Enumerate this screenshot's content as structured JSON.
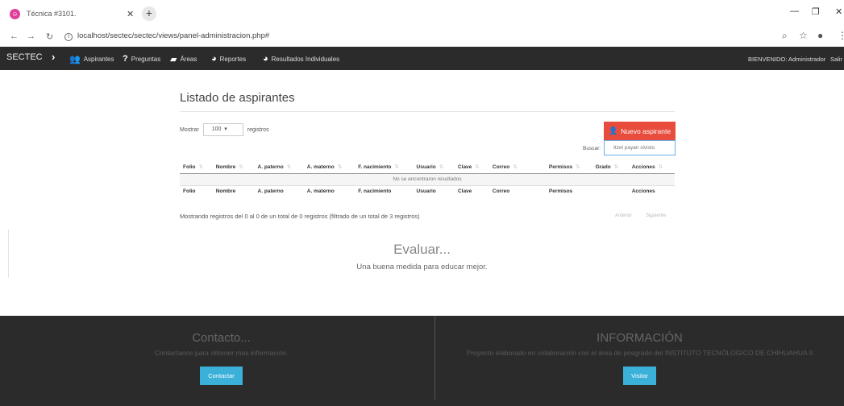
{
  "browser": {
    "tab_title": "Técnica #3101.",
    "url": "localhost/sectec/sectec/views/panel-administracion.php#"
  },
  "navbar": {
    "brand": "SECTEC",
    "items": [
      {
        "label": "Aspirantes",
        "icon": "users-icon"
      },
      {
        "label": "Preguntas",
        "icon": "question-icon"
      },
      {
        "label": "Áreas",
        "icon": "book-icon"
      },
      {
        "label": "Reportes",
        "icon": "pie-chart-icon"
      },
      {
        "label": "Resultados Individuales",
        "icon": "pie-chart-icon"
      }
    ],
    "welcome": "BIENVENIDO: Administrador",
    "logout": "Salir"
  },
  "main": {
    "title": "Listado de aspirantes",
    "show_label": "Mostrar",
    "show_value": "100",
    "records_label": "registros",
    "new_button": "Nuevo aspirante",
    "search_label": "Buscar:",
    "search_value": "Itzel payan sivisto",
    "columns": [
      "Folio",
      "Nombre",
      "A. paterno",
      "A. materno",
      "F. nacimiento",
      "Usuario",
      "Clave",
      "Correo",
      "Permisos",
      "Grado",
      "Acciones"
    ],
    "footer_columns": [
      "Folio",
      "Nombre",
      "A. paterno",
      "A. materno",
      "F. nacimiento",
      "Usuario",
      "Clave",
      "Correo",
      "Permisos",
      "Acciones"
    ],
    "empty_message": "No se encontraron resultados",
    "info": "Mostrando registros del 0 al 0 de un total de 0 registros (filtrado de un total de 3 registros)",
    "prev": "Anterior",
    "next": "Siguiente"
  },
  "hero": {
    "title": "Evaluar...",
    "subtitle": "Una buena medida para educar mejor."
  },
  "footer": {
    "contact_title": "Contacto...",
    "contact_text": "Contactanos para obtener mas información.",
    "contact_button": "Contactar",
    "info_title": "INFORMACIÓN",
    "info_text": "Proyecto elaborado en colaboración con el área de posgrado del INSTITUTO TECNÓLOGICO DE CHIHUAHUA II",
    "info_button": "Visitar"
  },
  "colors": {
    "navbar_bg": "#2b2b2b",
    "new_button": "#e74c3c",
    "footer_button": "#3bb0d9"
  }
}
